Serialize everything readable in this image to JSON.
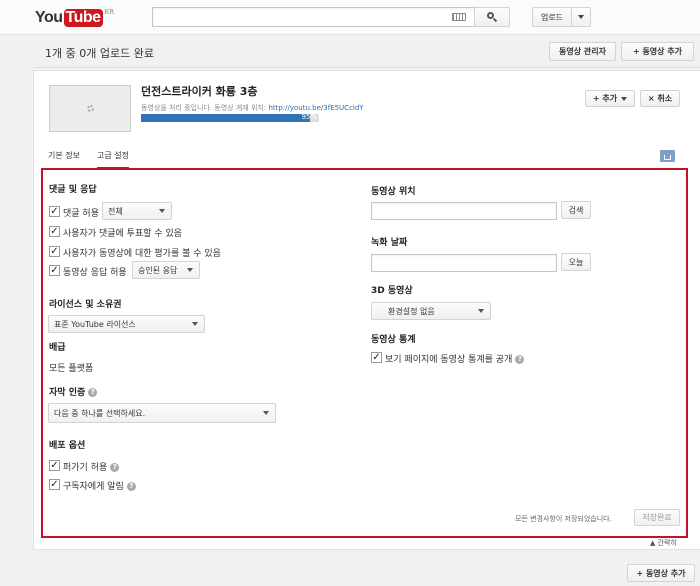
{
  "header": {
    "logo_you": "You",
    "logo_tube": "Tube",
    "logo_region": "KR",
    "search_placeholder": "",
    "upload_label": "업로드"
  },
  "toolbar": {
    "status": "1개 중 0개 업로드 완료",
    "video_manager": "동영상 관리자",
    "add_video": "+ 동영상 추가"
  },
  "video": {
    "title": "던전스트라이커 화룡 3층",
    "processing_text": "동영상을 처리 중입니다. 동영상 게재 위치:",
    "link": "http://youtu.be/3fE5UCcidY",
    "progress": 0.95,
    "progress_label": "95%",
    "add_label": "+ 추가",
    "cancel_label": "× 취소"
  },
  "tabs": [
    {
      "label": "기본 정보",
      "active": false
    },
    {
      "label": "고급 설정",
      "active": true
    }
  ],
  "left": {
    "comments_title": "댓글 및 응답",
    "allow_comments": "댓글 허용",
    "allow_comments_select": "전체",
    "vote_comments": "사용자가 댓글에 투표할 수 있음",
    "view_ratings": "사용자가 동영상에 대한 평가를 볼 수 있음",
    "video_responses": "동영상 응답 허용",
    "video_responses_select": "승인된 응답",
    "license_title": "라이선스 및 소유권",
    "license_select": "표준 YouTube 라이선스",
    "distribution_title": "배급",
    "distribution_value": "모든 플랫폼",
    "caption_title": "자막 인증",
    "caption_select": "다음 중 하나를 선택하세요.",
    "distribution_options_title": "배포 옵션",
    "allow_embed": "퍼가기 허용",
    "notify_subscribers": "구독자에게 알림"
  },
  "right": {
    "location_title": "동영상 위치",
    "search_button": "검색",
    "record_date_title": "녹화 날짜",
    "today_button": "오늘",
    "threed_title": "3D 동영상",
    "threed_select": "환경설정 없음",
    "stats_title": "동영상 통계",
    "stats_checkbox": "보기 페이지에 동영상 통계를 공개"
  },
  "footer": {
    "saved_msg": "모든 변경사항이 저장되었습니다.",
    "save_button": "저장완료",
    "collapse": "▲ 간략히",
    "add_video": "+ 동영상 추가"
  },
  "colors": {
    "highlight_border": "#c8102e",
    "progress_bar": "#2f73b8",
    "logo_red": "#cc181e",
    "link": "#2a6fb5"
  }
}
